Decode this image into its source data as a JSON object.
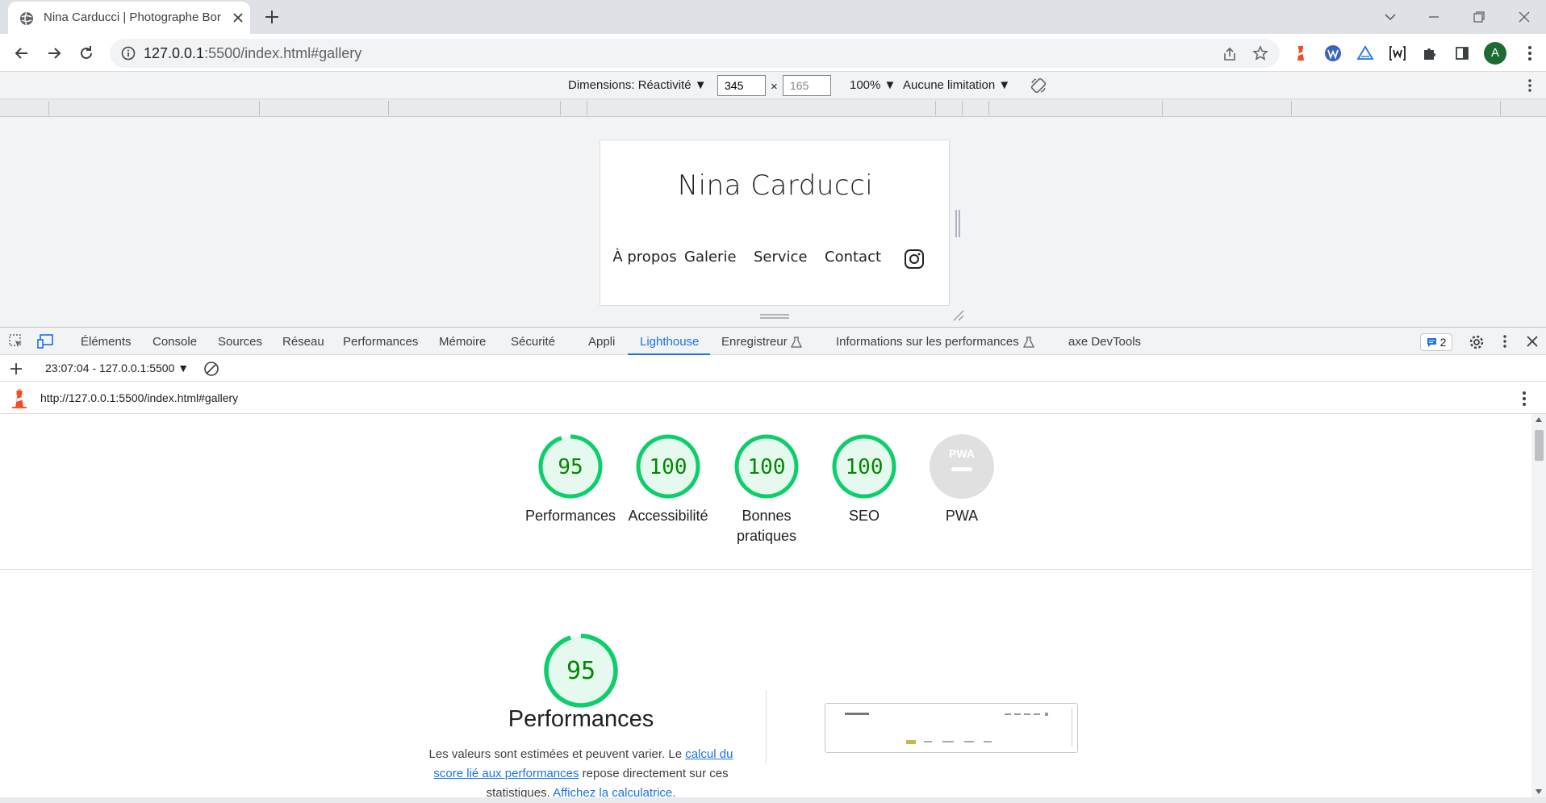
{
  "browser": {
    "tab_title": "Nina Carducci | Photographe Bor",
    "url_host": "127.0.0.1",
    "url_path": ":5500/index.html#gallery",
    "avatar_letter": "A"
  },
  "device_toolbar": {
    "dimensions_label": "Dimensions: Réactivité",
    "width": "345",
    "times": "×",
    "height": "165",
    "zoom": "100%",
    "throttling": "Aucune limitation"
  },
  "emulated_site": {
    "title": "Nina Carducci",
    "nav": [
      "À propos",
      "Galerie",
      "Service",
      "Contact"
    ]
  },
  "devtools": {
    "tabs": [
      "Éléments",
      "Console",
      "Sources",
      "Réseau",
      "Performances",
      "Mémoire",
      "Sécurité",
      "Appli",
      "Lighthouse",
      "Enregistreur",
      "Informations sur les performances",
      "axe DevTools"
    ],
    "active_tab": "Lighthouse",
    "issues_count": "2",
    "report_select": "23:07:04 - 127.0.0.1:5500",
    "report_url": "http://127.0.0.1:5500/index.html#gallery"
  },
  "scores": [
    {
      "label": "Performances",
      "value": "95"
    },
    {
      "label": "Accessibilité",
      "value": "100"
    },
    {
      "label": "Bonnes pratiques",
      "value": "100"
    },
    {
      "label": "SEO",
      "value": "100"
    },
    {
      "label": "PWA",
      "value": "PWA"
    }
  ],
  "performance_section": {
    "score": "95",
    "title": "Performances",
    "desc_1": "Les valeurs sont estimées et peuvent varier. Le ",
    "link_1": "calcul du score lié aux performances",
    "desc_2": " repose directement sur ces statistiques. ",
    "link_2": "Affichez la calculatrice."
  },
  "colors": {
    "pass_green": "#0cce6b",
    "pass_text": "#008800",
    "pass_fill": "#e6f9ef",
    "pwa_grey": "#e0e0e0",
    "link_blue": "#1a73e8"
  }
}
